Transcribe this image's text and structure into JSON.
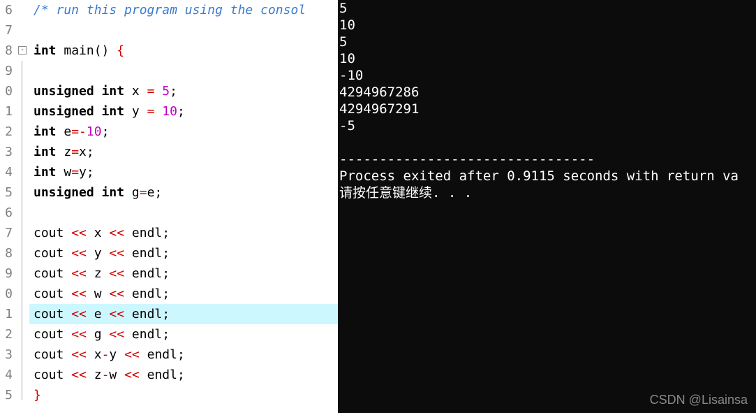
{
  "editor": {
    "line_numbers": [
      "6",
      "7",
      "8",
      "9",
      "0",
      "1",
      "2",
      "3",
      "4",
      "5",
      "6",
      "7",
      "8",
      "9",
      "0",
      "1",
      "2",
      "3",
      "4",
      "5"
    ],
    "highlight_index": 15,
    "fold": {
      "row": 2,
      "symbol": "-"
    },
    "lines": [
      {
        "tokens": [
          {
            "t": "/* run this program using the consol",
            "c": "c-comment"
          }
        ]
      },
      {
        "tokens": []
      },
      {
        "tokens": [
          {
            "t": "int",
            "c": "c-keyword"
          },
          {
            "t": " "
          },
          {
            "t": "main",
            "c": "c-ident"
          },
          {
            "t": "()",
            "c": "c-paren"
          },
          {
            "t": " "
          },
          {
            "t": "{",
            "c": "c-brace"
          }
        ]
      },
      {
        "tokens": []
      },
      {
        "tokens": [
          {
            "t": "unsigned",
            "c": "c-keyword"
          },
          {
            "t": " "
          },
          {
            "t": "int",
            "c": "c-keyword"
          },
          {
            "t": " x "
          },
          {
            "t": "=",
            "c": "c-op"
          },
          {
            "t": " "
          },
          {
            "t": "5",
            "c": "c-num"
          },
          {
            "t": ";",
            "c": "c-semi"
          }
        ]
      },
      {
        "tokens": [
          {
            "t": "unsigned",
            "c": "c-keyword"
          },
          {
            "t": " "
          },
          {
            "t": "int",
            "c": "c-keyword"
          },
          {
            "t": " y "
          },
          {
            "t": "=",
            "c": "c-op"
          },
          {
            "t": " "
          },
          {
            "t": "10",
            "c": "c-num"
          },
          {
            "t": ";",
            "c": "c-semi"
          }
        ]
      },
      {
        "tokens": [
          {
            "t": "int",
            "c": "c-keyword"
          },
          {
            "t": " e"
          },
          {
            "t": "=-",
            "c": "c-op"
          },
          {
            "t": "10",
            "c": "c-num"
          },
          {
            "t": ";",
            "c": "c-semi"
          }
        ]
      },
      {
        "tokens": [
          {
            "t": "int",
            "c": "c-keyword"
          },
          {
            "t": " z"
          },
          {
            "t": "=",
            "c": "c-op"
          },
          {
            "t": "x"
          },
          {
            "t": ";",
            "c": "c-semi"
          }
        ]
      },
      {
        "tokens": [
          {
            "t": "int",
            "c": "c-keyword"
          },
          {
            "t": " w"
          },
          {
            "t": "=",
            "c": "c-op"
          },
          {
            "t": "y"
          },
          {
            "t": ";",
            "c": "c-semi"
          }
        ]
      },
      {
        "tokens": [
          {
            "t": "unsigned",
            "c": "c-keyword"
          },
          {
            "t": " "
          },
          {
            "t": "int",
            "c": "c-keyword"
          },
          {
            "t": " g"
          },
          {
            "t": "=",
            "c": "c-op"
          },
          {
            "t": "e"
          },
          {
            "t": ";",
            "c": "c-semi"
          }
        ]
      },
      {
        "tokens": []
      },
      {
        "tokens": [
          {
            "t": "cout "
          },
          {
            "t": "<<",
            "c": "c-op"
          },
          {
            "t": " x "
          },
          {
            "t": "<<",
            "c": "c-op"
          },
          {
            "t": " endl"
          },
          {
            "t": ";",
            "c": "c-semi"
          }
        ]
      },
      {
        "tokens": [
          {
            "t": "cout "
          },
          {
            "t": "<<",
            "c": "c-op"
          },
          {
            "t": " y "
          },
          {
            "t": "<<",
            "c": "c-op"
          },
          {
            "t": " endl"
          },
          {
            "t": ";",
            "c": "c-semi"
          }
        ]
      },
      {
        "tokens": [
          {
            "t": "cout "
          },
          {
            "t": "<<",
            "c": "c-op"
          },
          {
            "t": " z "
          },
          {
            "t": "<<",
            "c": "c-op"
          },
          {
            "t": " endl"
          },
          {
            "t": ";",
            "c": "c-semi"
          }
        ]
      },
      {
        "tokens": [
          {
            "t": "cout "
          },
          {
            "t": "<<",
            "c": "c-op"
          },
          {
            "t": " w "
          },
          {
            "t": "<<",
            "c": "c-op"
          },
          {
            "t": " endl"
          },
          {
            "t": ";",
            "c": "c-semi"
          }
        ]
      },
      {
        "tokens": [
          {
            "t": "cout "
          },
          {
            "t": "<<",
            "c": "c-op"
          },
          {
            "t": " e "
          },
          {
            "t": "<<",
            "c": "c-op"
          },
          {
            "t": " endl"
          },
          {
            "t": ";",
            "c": "c-semi"
          }
        ]
      },
      {
        "tokens": [
          {
            "t": "cout "
          },
          {
            "t": "<<",
            "c": "c-op"
          },
          {
            "t": " g "
          },
          {
            "t": "<<",
            "c": "c-op"
          },
          {
            "t": " endl"
          },
          {
            "t": ";",
            "c": "c-semi"
          }
        ]
      },
      {
        "tokens": [
          {
            "t": "cout "
          },
          {
            "t": "<<",
            "c": "c-op"
          },
          {
            "t": " x"
          },
          {
            "t": "-",
            "c": "c-op"
          },
          {
            "t": "y "
          },
          {
            "t": "<<",
            "c": "c-op"
          },
          {
            "t": " endl"
          },
          {
            "t": ";",
            "c": "c-semi"
          }
        ]
      },
      {
        "tokens": [
          {
            "t": "cout "
          },
          {
            "t": "<<",
            "c": "c-op"
          },
          {
            "t": " z"
          },
          {
            "t": "-",
            "c": "c-op"
          },
          {
            "t": "w "
          },
          {
            "t": "<<",
            "c": "c-op"
          },
          {
            "t": " endl"
          },
          {
            "t": ";",
            "c": "c-semi"
          }
        ]
      },
      {
        "tokens": [
          {
            "t": "}",
            "c": "c-brace"
          }
        ]
      }
    ]
  },
  "console": {
    "lines": [
      "5",
      "10",
      "5",
      "10",
      "-10",
      "4294967286",
      "4294967291",
      "-5",
      "",
      "--------------------------------",
      "Process exited after 0.9115 seconds with return va",
      "请按任意键继续. . ."
    ]
  },
  "watermark": "CSDN @Lisainsa"
}
